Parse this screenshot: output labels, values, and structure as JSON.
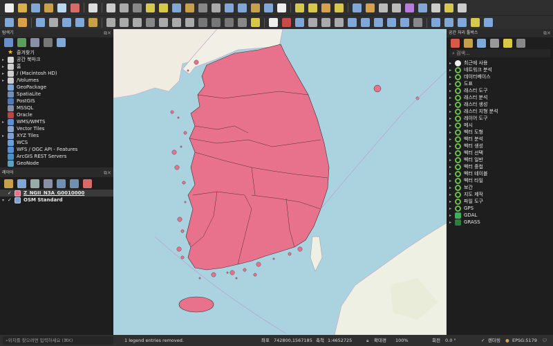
{
  "browser": {
    "title": "탐색기",
    "items": [
      {
        "label": "즐겨찾기",
        "color": "#f2c233",
        "expand": "",
        "glyph": "★"
      },
      {
        "label": "공간 북마크",
        "color": "#d9d9d9",
        "expand": "▸",
        "glyph": ""
      },
      {
        "label": "홈",
        "color": "#cfcfcf",
        "expand": "▸",
        "glyph": ""
      },
      {
        "label": "/ (Macintosh HD)",
        "color": "#cfcfcf",
        "expand": "▸",
        "glyph": ""
      },
      {
        "label": "/Volumes",
        "color": "#cfcfcf",
        "expand": "▸",
        "glyph": ""
      },
      {
        "label": "GeoPackage",
        "color": "#7aa6d8",
        "expand": "",
        "glyph": ""
      },
      {
        "label": "SpatiaLite",
        "color": "#6f8fb3",
        "expand": "",
        "glyph": ""
      },
      {
        "label": "PostGIS",
        "color": "#4f7bb8",
        "expand": "",
        "glyph": ""
      },
      {
        "label": "MSSQL",
        "color": "#8a8fa8",
        "expand": "",
        "glyph": ""
      },
      {
        "label": "Oracle",
        "color": "#b84646",
        "expand": "",
        "glyph": ""
      },
      {
        "label": "WMS/WMTS",
        "color": "#5b8fd6",
        "expand": "▸",
        "glyph": ""
      },
      {
        "label": "Vector Tiles",
        "color": "#8aa3c8",
        "expand": "",
        "glyph": ""
      },
      {
        "label": "XYZ Tiles",
        "color": "#7f9fcf",
        "expand": "▸",
        "glyph": ""
      },
      {
        "label": "WCS",
        "color": "#6aa0d8",
        "expand": "",
        "glyph": ""
      },
      {
        "label": "WFS / OGC API - Features",
        "color": "#5b8fd6",
        "expand": "",
        "glyph": ""
      },
      {
        "label": "ArcGIS REST Servers",
        "color": "#4a90c8",
        "expand": "",
        "glyph": ""
      },
      {
        "label": "GeoNode",
        "color": "#5fa0c0",
        "expand": "",
        "glyph": ""
      }
    ]
  },
  "layers": {
    "title": "레이어",
    "items": [
      {
        "label": "Z_NGII_N3A_G0010000",
        "swatch": "#e8728c",
        "expand": ""
      },
      {
        "label": "OSM Standard",
        "swatch": "#7f9fcf",
        "expand": "▾"
      }
    ]
  },
  "processing": {
    "title": "공간 처리 툴박스",
    "search_placeholder": "검색...",
    "items": [
      {
        "label": "최근에 사용",
        "icon": "clock"
      },
      {
        "label": "네트워크 분석",
        "icon": "q"
      },
      {
        "label": "데이터베이스",
        "icon": "q"
      },
      {
        "label": "도표",
        "icon": "q"
      },
      {
        "label": "래스터 도구",
        "icon": "q"
      },
      {
        "label": "래스터 분석",
        "icon": "q"
      },
      {
        "label": "래스터 생성",
        "icon": "q"
      },
      {
        "label": "래스터 지형 분석",
        "icon": "q"
      },
      {
        "label": "레이어 도구",
        "icon": "q"
      },
      {
        "label": "메시",
        "icon": "q"
      },
      {
        "label": "벡터 도형",
        "icon": "q"
      },
      {
        "label": "벡터 분석",
        "icon": "q"
      },
      {
        "label": "벡터 생성",
        "icon": "q"
      },
      {
        "label": "벡터 선택",
        "icon": "q"
      },
      {
        "label": "벡터 일반",
        "icon": "q"
      },
      {
        "label": "벡터 중첩",
        "icon": "q"
      },
      {
        "label": "벡터 테이블",
        "icon": "q"
      },
      {
        "label": "벡터 타일",
        "icon": "q"
      },
      {
        "label": "보간",
        "icon": "q"
      },
      {
        "label": "지도 제작",
        "icon": "q"
      },
      {
        "label": "파일 도구",
        "icon": "q"
      },
      {
        "label": "GPS",
        "icon": "q"
      },
      {
        "label": "GDAL",
        "icon": "gdal"
      },
      {
        "label": "GRASS",
        "icon": "grass"
      }
    ]
  },
  "status": {
    "locator_placeholder": "위치를 찾으려면 입력하세요 (⌘K)",
    "message": "1 legend entries removed.",
    "coord_label": "좌표",
    "coord_value": "742800,1567185",
    "scale_label": "축척",
    "scale_value": "1:4652725",
    "magnifier_label": "확대경",
    "magnifier_value": "100%",
    "rotation_label": "회전",
    "rotation_value": "0.0 °",
    "render_label": "렌더링",
    "crs": "EPSG:5179"
  },
  "colors": {
    "land": "#e8728c",
    "sea": "#aad3df",
    "accent": "#6abf4b"
  }
}
